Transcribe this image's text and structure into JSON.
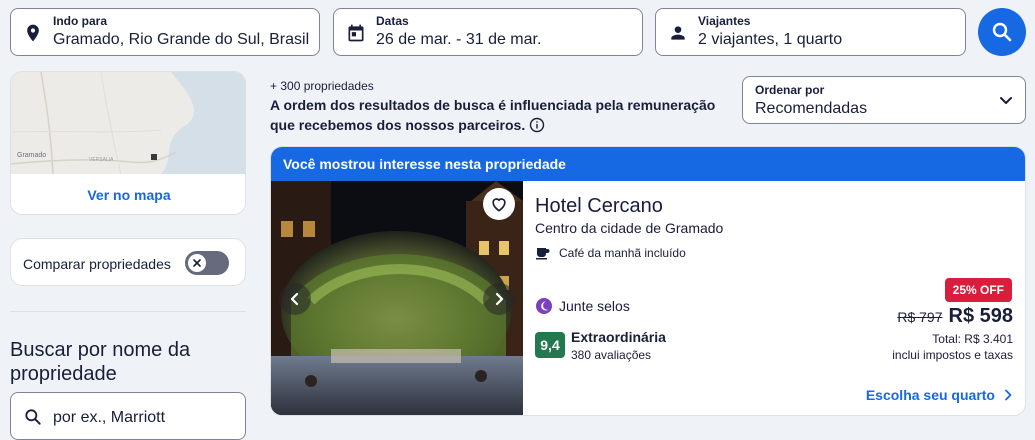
{
  "search": {
    "destination": {
      "label": "Indo para",
      "value": "Gramado, Rio Grande do Sul, Brasil"
    },
    "dates": {
      "label": "Datas",
      "value": "26 de mar. - 31 de mar."
    },
    "travelers": {
      "label": "Viajantes",
      "value": "2 viajantes, 1 quarto"
    }
  },
  "sidebar": {
    "map_link": "Ver no mapa",
    "map_labels": [
      "Gramado",
      "VERSALIA"
    ],
    "compare_label": "Comparar propriedades",
    "name_search_title": "Buscar por nome da propriedade",
    "name_search_placeholder": "por ex., Marriott"
  },
  "results": {
    "count": "+ 300 propriedades",
    "order_note": "A ordem dos resultados de busca é influenciada pela remuneração que recebemos dos nossos parceiros.",
    "sort_label": "Ordenar por",
    "sort_value": "Recomendadas"
  },
  "property": {
    "banner": "Você mostrou interesse nesta propriedade",
    "name": "Hotel Cercano",
    "area": "Centro da cidade de Gramado",
    "amenity": "Café da manhã incluído",
    "loyalty": "Junte selos",
    "score": "9,4",
    "score_label": "Extraordinária",
    "reviews": "380 avaliações",
    "discount": "25% OFF",
    "old_price": "R$ 797",
    "price": "R$ 598",
    "total": "Total: R$ 3.401",
    "taxes": "inclui impostos e taxas",
    "cta": "Escolha seu quarto"
  },
  "colors": {
    "accent": "#1668e3",
    "discount": "#d91e3d",
    "score": "#227950",
    "loyalty": "#7b3fbf"
  }
}
